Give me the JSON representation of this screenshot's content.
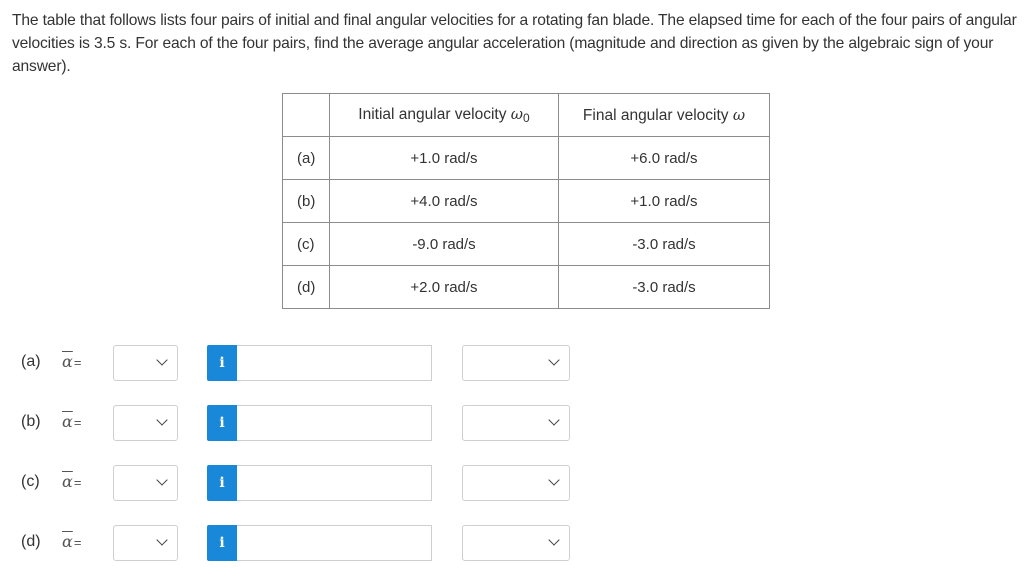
{
  "question": {
    "text": "The table that follows lists four pairs of initial and final angular velocities for a rotating fan blade. The elapsed time for each of the four pairs of angular velocities is 3.5 s. For each of the four pairs, find the average angular acceleration (magnitude and direction as given by the algebraic sign of your answer)."
  },
  "table": {
    "headers": {
      "blank": "",
      "initial_label": "Initial angular velocity ",
      "initial_symbol": "ω",
      "initial_subscript": "0",
      "final_label": "Final angular velocity ",
      "final_symbol": "ω"
    },
    "rows": [
      {
        "label": "(a)",
        "initial": "+1.0 rad/s",
        "final": "+6.0 rad/s"
      },
      {
        "label": "(b)",
        "initial": "+4.0 rad/s",
        "final": "+1.0 rad/s"
      },
      {
        "label": "(c)",
        "initial": "-9.0 rad/s",
        "final": "-3.0 rad/s"
      },
      {
        "label": "(d)",
        "initial": "+2.0 rad/s",
        "final": "-3.0 rad/s"
      }
    ]
  },
  "answers": [
    {
      "label": "(a)",
      "symbol": "α",
      "equals": "=",
      "sign_value": "",
      "info_icon": "i",
      "value": "",
      "unit_value": ""
    },
    {
      "label": "(b)",
      "symbol": "α",
      "equals": "=",
      "sign_value": "",
      "info_icon": "i",
      "value": "",
      "unit_value": ""
    },
    {
      "label": "(c)",
      "symbol": "α",
      "equals": "=",
      "sign_value": "",
      "info_icon": "i",
      "value": "",
      "unit_value": ""
    },
    {
      "label": "(d)",
      "symbol": "α",
      "equals": "=",
      "sign_value": "",
      "info_icon": "i",
      "value": "",
      "unit_value": ""
    }
  ],
  "colors": {
    "info_button": "#1a88d9",
    "text": "#333333",
    "border": "#cfcfcf"
  }
}
